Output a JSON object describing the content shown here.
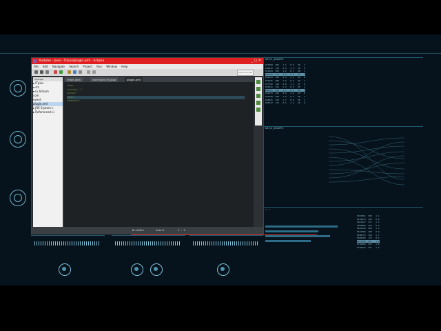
{
  "eclipse": {
    "title": "Youtube - Java - ITplus/plugin.yml - Eclipse",
    "window_controls": "_ ▢ ✕",
    "menu": [
      "File",
      "Edit",
      "Navigate",
      "Search",
      "Project",
      "Run",
      "Window",
      "Help"
    ],
    "quick_access": "Quick Access",
    "explorer_title": "Package",
    "tree": [
      "▸ ITplus",
      "  ▾ src",
      "    ▾ ru.hiteam",
      "      com",
      "      event",
      "      plugin.yml",
      "  ▸ JRE System L",
      "  ▸ Referenced Li"
    ],
    "tabs": [
      "main.java",
      "command_fly.java",
      "plugin.yml"
    ],
    "code": [
      "name: ",
      "version: 1",
      "author: ",
      "main: ",
      "commands:",
      "  "
    ],
    "status": [
      "Writable",
      "Insert",
      "3 : 1"
    ]
  },
  "hud": {
    "top_labels": [
      "— — — —",
      "— — — — — —",
      "— — — — —",
      "— — — — —"
    ],
    "panels": [
      {
        "title": "DATA_QUANTS"
      },
      {
        "title": "DATA_QUANTS"
      },
      {
        "title": "— —"
      }
    ]
  },
  "colors": {
    "accent": "#8fc6d8",
    "titlebar": "#e02020",
    "alert": "#d12a2a"
  }
}
